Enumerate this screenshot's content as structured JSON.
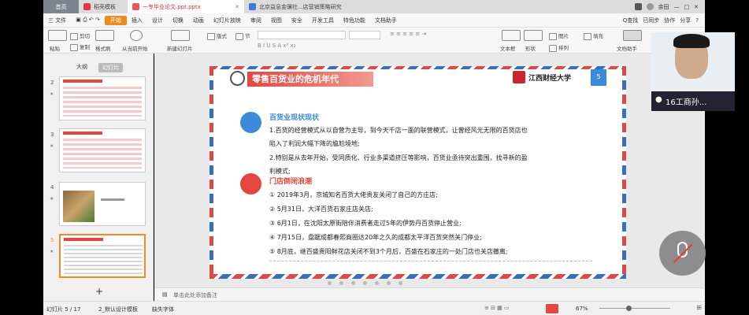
{
  "tabs": {
    "home": "首页",
    "t1": "稻壳模板",
    "t2": "一专毕业论文.ppt.pptx",
    "t3": "北京益息金骥社...店营销策略研究",
    "user": "余田"
  },
  "menu": {
    "file": "三 文件",
    "start": "开始",
    "items": [
      "插入",
      "设计",
      "切换",
      "动画",
      "幻灯片放映",
      "审阅",
      "视图",
      "安全",
      "开发工具",
      "特色功能",
      "文档助手"
    ],
    "search": "Q查找",
    "sync": "已同步",
    "collab": "协作",
    "share": "分享"
  },
  "toolbar": {
    "paste": "粘贴",
    "cut": "剪切",
    "copy": "复制",
    "format": "格式刷",
    "play": "从当前开始",
    "newslide": "新建幻灯片",
    "layout": "版式",
    "section": "节",
    "textbox": "文本框",
    "shape": "形状",
    "arrange": "排列",
    "picture": "图片",
    "fill": "填充",
    "assist": "文档助手",
    "find": "查找"
  },
  "panel": {
    "outline": "大纲",
    "slides": "幻灯片",
    "nums": [
      "2",
      "3",
      "4",
      "5"
    ],
    "add": "+"
  },
  "slide": {
    "title": "零售百货业的危机年代",
    "number": "5",
    "university": "江西财经大学",
    "section1": "百货业现状现状",
    "p1": "1.百货的经营模式从以自营为主导，到今天千店一面的联营模式，让曾经风光无限的百货店也",
    "p1b": "陷入了利润大幅下降的尴尬境地;",
    "p2": "2.特别是从去年开始，受同质化、行业多渠道挤压等影响，百货业亟待突出重围，找寻新的盈",
    "p2b": "利模式;",
    "section2": "门店倒闭浪潮",
    "items": [
      "①  2019年3月，京城知名百货大佬贵友关闭了自己的方庄店;",
      "②  5月31日，大洋百货石家庄店关店;",
      "③  6月1日，在沈阳太原街陪伴消费者走过5年的伊势丹百货停止营业;",
      "④  7月15日，盘踞成都春熙商圈达20年之久的成都太平洋百货突然关门停业;",
      "⑤   8月底，继百盛贵阳鲜花店关闭不到3个月后，百盛在石家庄的一处门店也关店撤离;"
    ]
  },
  "notes": "单击此处添加备注",
  "status": {
    "slide": "幻灯片 5 / 17",
    "theme": "2_默认设计模板",
    "font": "缺失字体",
    "zoom": "67%"
  },
  "video": {
    "name": "16工商孙..."
  },
  "colors": {
    "accent": "#f08b24",
    "titlered": "#e3473f",
    "blue": "#3d8ad9"
  }
}
